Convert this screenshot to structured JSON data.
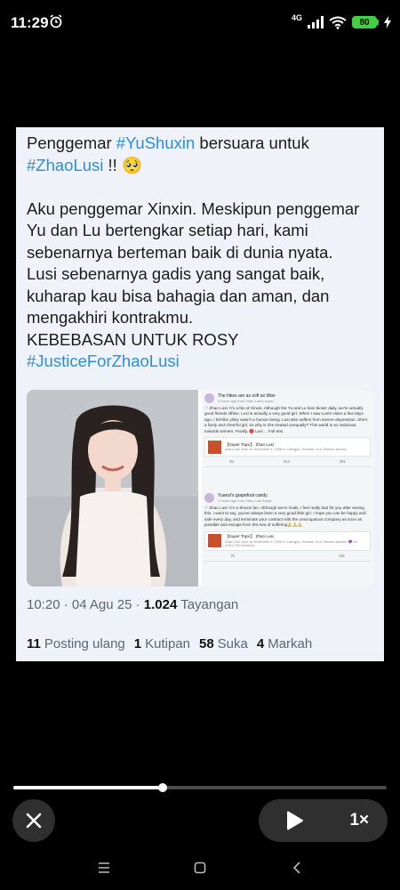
{
  "status_bar": {
    "time": "11:29",
    "network": "4G",
    "battery": "80"
  },
  "tweet": {
    "lines": [
      {
        "type": "text",
        "parts": [
          {
            "t": "Penggemar "
          },
          {
            "t": "#YuShuxin",
            "tag": true
          },
          {
            "t": " bersuara untuk"
          }
        ]
      },
      {
        "type": "text",
        "parts": [
          {
            "t": "#ZhaoLusi",
            "tag": true
          },
          {
            "t": " !! 🥺"
          }
        ]
      },
      {
        "type": "gap"
      },
      {
        "type": "text",
        "parts": [
          {
            "t": "Aku penggemar Xinxin. Meskipun penggemar"
          }
        ]
      },
      {
        "type": "text",
        "parts": [
          {
            "t": "Yu dan Lu bertengkar setiap hari, kami"
          }
        ]
      },
      {
        "type": "text",
        "parts": [
          {
            "t": "sebenarnya berteman baik di dunia nyata."
          }
        ]
      },
      {
        "type": "text",
        "parts": [
          {
            "t": "Lusi sebenarnya gadis yang sangat baik,"
          }
        ]
      },
      {
        "type": "text",
        "parts": [
          {
            "t": "kuharap kau bisa bahagia dan aman, dan"
          }
        ]
      },
      {
        "type": "text",
        "parts": [
          {
            "t": "mengakhiri kontrakmu."
          }
        ]
      },
      {
        "type": "text",
        "parts": [
          {
            "t": "KEBEBASAN UNTUK ROSY"
          }
        ]
      },
      {
        "type": "text",
        "parts": [
          {
            "t": "#JusticeForZhaoLusi",
            "tag": true
          }
        ]
      }
    ],
    "embedded_posts": [
      {
        "name": "The hikes are as soft as Wan",
        "time": "2 hours ago from Zhao Lusi's super",
        "body": "♡ Zhao Lusi: I'm a fan of Xinxin. Although the Yu and Lu fans bicker daily, we're actually good friends offline. Lusi is actually a very good girl. When I saw Lusi's video a few days ago, I felt like yhiky wasn't a human being. Lusi also suffers from severe depression. She's a lively and cheerful girl, so why is she treated unequally? This world is so malicious towards women. Finally, 🔴 Lusi ... Full text",
        "topic_title": "【Super Topic】 Zhao Lusi",
        "topic_desc": "Zhao Lusi, born on November 9, 1998 in Chengdu, Sichuan, is a Chinese actress.",
        "actions": [
          "25",
          "914",
          "381"
        ]
      },
      {
        "name": "Yuanzi's grapefruit candy",
        "time": "3 hours ago from Zhao Lusi Super",
        "body": "♡ Zhao Lusi: I'm a Shuxin fan. Although we're rivals, I feel really bad for you after seeing this. I want to say, you've always been a very good little girl. I hope you can be happy and safe every day, and terminate your contract with the unscrupulous company as soon as possible and escape from this sea of suffering🙏🙏🙏",
        "topic_title": "【Super Topic】 Zhao Lusi",
        "topic_desc": "Zhao Lusi, born on November 9, 1998 in Chengdu, Sichuan, is a Chinese actress. 💜 Air 4,331,750 followers",
        "actions": [
          "79",
          "",
          "136"
        ]
      }
    ],
    "timestamp": "10:20 · 04 Agu 25 · ",
    "views_count": "1.024",
    "views_label": " Tayangan",
    "stats": [
      {
        "count": "11",
        "label": "Posting ulang"
      },
      {
        "count": "1",
        "label": "Kutipan"
      },
      {
        "count": "58",
        "label": "Suka"
      },
      {
        "count": "4",
        "label": "Markah"
      }
    ]
  },
  "player": {
    "progress": 0.4,
    "speed_label": "1×",
    "icons": {
      "close": "close-icon",
      "play": "play-icon"
    }
  },
  "nav": {
    "icons": [
      "menu-icon",
      "home-icon",
      "back-icon"
    ]
  }
}
